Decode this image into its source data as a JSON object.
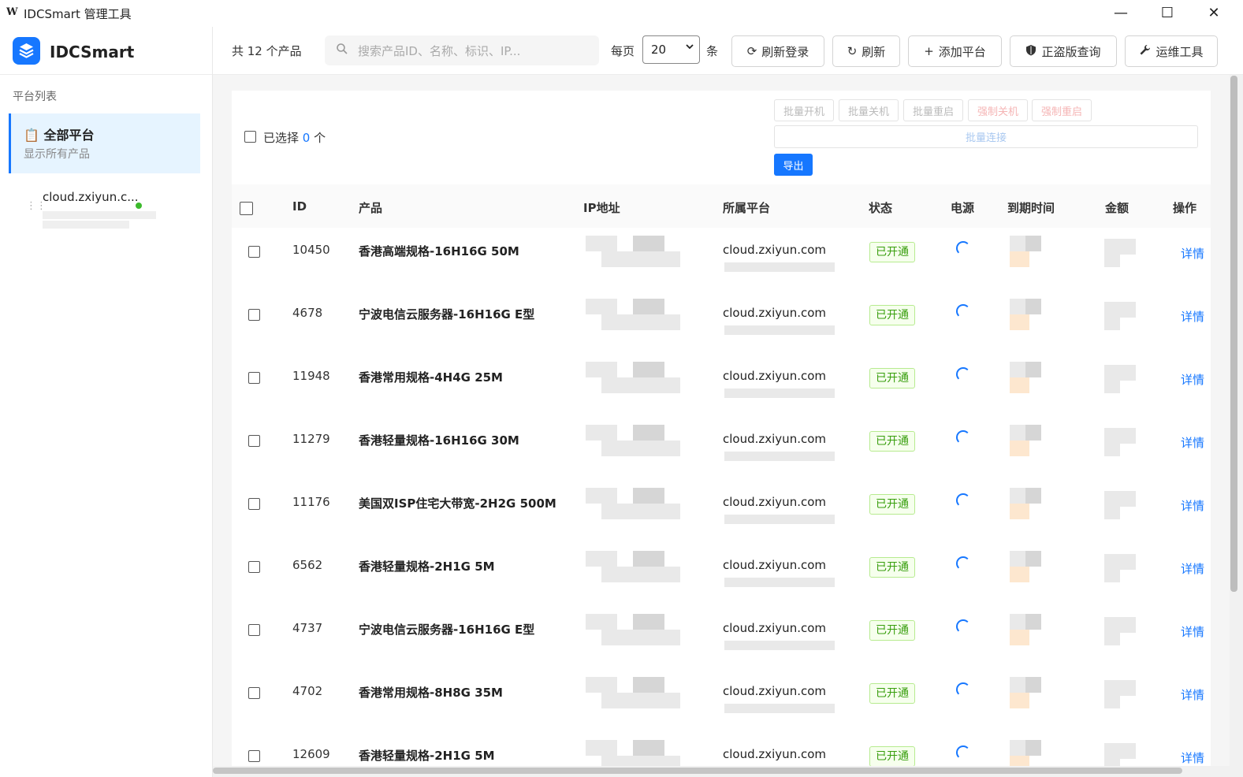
{
  "window": {
    "logo": "W",
    "title": "IDCSmart 管理工具",
    "minimize": "—",
    "maximize": "☐",
    "close": "✕"
  },
  "sidebar": {
    "brand": "IDCSmart",
    "section_label": "平台列表",
    "all_platforms": {
      "icon": "📋",
      "title": "全部平台",
      "subtitle": "显示所有产品"
    },
    "platforms": [
      {
        "name": "cloud.zxiyun.c...",
        "status_color": "#3cba2c"
      }
    ]
  },
  "toolbar": {
    "count": "共 12 个产品",
    "search_placeholder": "搜索产品ID、名称、标识、IP...",
    "per_page_label": "每页",
    "per_page_value": "20",
    "per_page_unit": "条",
    "buttons": {
      "refresh_login": "刷新登录",
      "refresh": "刷新",
      "add_platform": "添加平台",
      "license_check": "正盗版查询",
      "ops_tools": "运维工具"
    }
  },
  "batch": {
    "selected_prefix": "已选择",
    "selected_count": "0",
    "selected_suffix": "个",
    "power_on": "批量开机",
    "power_off": "批量关机",
    "reboot": "批量重启",
    "force_off": "强制关机",
    "force_reboot": "强制重启",
    "connect": "批量连接",
    "export": "导出"
  },
  "table": {
    "headers": {
      "id": "ID",
      "product": "产品",
      "ip": "IP地址",
      "platform": "所属平台",
      "status": "状态",
      "power": "电源",
      "expire": "到期时间",
      "amount": "金额",
      "actions": "操作"
    },
    "detail_label": "详情",
    "rows": [
      {
        "id": "10450",
        "product": "香港高端规格-16H16G 50M",
        "platform": "cloud.zxiyun.com",
        "status": "已开通"
      },
      {
        "id": "4678",
        "product": "宁波电信云服务器-16H16G E型",
        "platform": "cloud.zxiyun.com",
        "status": "已开通"
      },
      {
        "id": "11948",
        "product": "香港常用规格-4H4G 25M",
        "platform": "cloud.zxiyun.com",
        "status": "已开通"
      },
      {
        "id": "11279",
        "product": "香港轻量规格-16H16G 30M",
        "platform": "cloud.zxiyun.com",
        "status": "已开通"
      },
      {
        "id": "11176",
        "product": "美国双ISP住宅大带宽-2H2G 500M",
        "platform": "cloud.zxiyun.com",
        "status": "已开通"
      },
      {
        "id": "6562",
        "product": "香港轻量规格-2H1G 5M",
        "platform": "cloud.zxiyun.com",
        "status": "已开通"
      },
      {
        "id": "4737",
        "product": "宁波电信云服务器-16H16G E型",
        "platform": "cloud.zxiyun.com",
        "status": "已开通"
      },
      {
        "id": "4702",
        "product": "香港常用规格-8H8G 35M",
        "platform": "cloud.zxiyun.com",
        "status": "已开通"
      },
      {
        "id": "12609",
        "product": "香港轻量规格-2H1G 5M",
        "platform": "cloud.zxiyun.com",
        "status": "已开通"
      }
    ]
  },
  "colors": {
    "accent": "#1677ff",
    "success": "#389e0d",
    "danger_light": "#f5b5b5"
  }
}
